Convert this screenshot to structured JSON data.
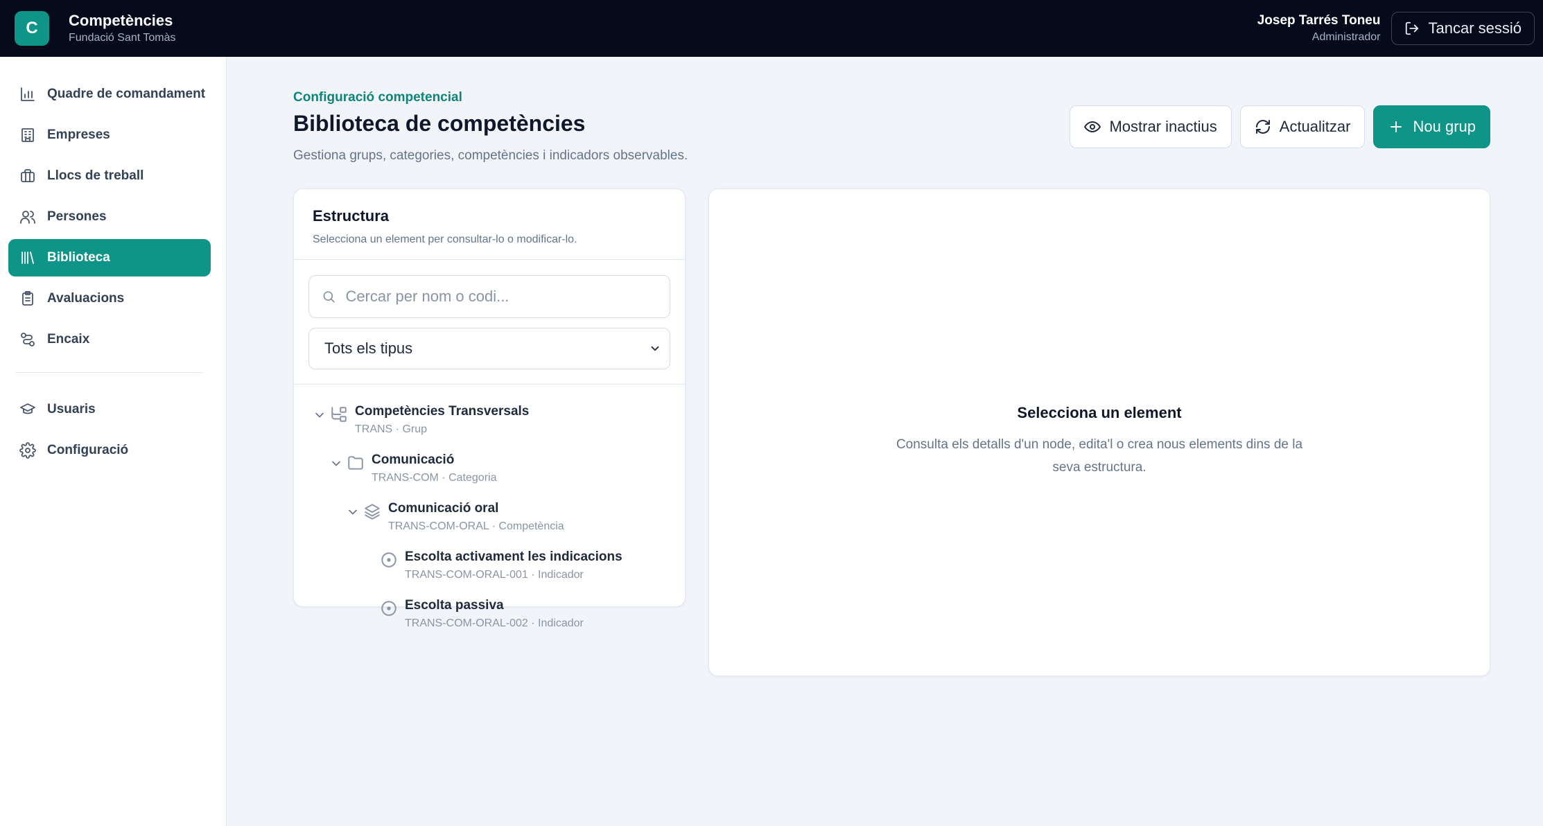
{
  "app": {
    "logo_letter": "C",
    "title": "Competències",
    "org": "Fundació Sant Tomàs"
  },
  "user": {
    "name": "Josep Tarrés Toneu",
    "role": "Administrador",
    "logout_label": "Tancar sessió"
  },
  "sidebar": {
    "items": [
      {
        "label": "Quadre de comandament",
        "icon": "bar-chart-icon"
      },
      {
        "label": "Empreses",
        "icon": "building-icon"
      },
      {
        "label": "Llocs de treball",
        "icon": "briefcase-icon"
      },
      {
        "label": "Persones",
        "icon": "users-icon"
      },
      {
        "label": "Biblioteca",
        "icon": "library-icon",
        "active": true
      },
      {
        "label": "Avaluacions",
        "icon": "clipboard-icon"
      },
      {
        "label": "Encaix",
        "icon": "route-icon"
      }
    ],
    "secondary": [
      {
        "label": "Usuaris",
        "icon": "graduation-cap-icon"
      },
      {
        "label": "Configuració",
        "icon": "gear-icon"
      }
    ]
  },
  "page": {
    "eyebrow": "Configuració competencial",
    "title": "Biblioteca de competències",
    "subtitle": "Gestiona grups, categories, competències i indicadors observables.",
    "actions": {
      "show_inactive": "Mostrar inactius",
      "refresh": "Actualitzar",
      "new_group": "Nou grup"
    }
  },
  "structure": {
    "title": "Estructura",
    "subtitle": "Selecciona un element per consultar-lo o modificar-lo.",
    "search_placeholder": "Cercar per nom o codi...",
    "type_filter": "Tots els tipus",
    "nodes": [
      {
        "label": "Competències Transversals",
        "meta": "TRANS · Grup",
        "level": 0,
        "expandable": true,
        "icon": "group-tree-icon"
      },
      {
        "label": "Comunicació",
        "meta": "TRANS-COM · Categoria",
        "level": 1,
        "expandable": true,
        "icon": "folder-icon"
      },
      {
        "label": "Comunicació oral",
        "meta": "TRANS-COM-ORAL · Competència",
        "level": 2,
        "expandable": true,
        "icon": "layers-icon"
      },
      {
        "label": "Escolta activament les indicacions",
        "meta": "TRANS-COM-ORAL-001 · Indicador",
        "level": 3,
        "expandable": false,
        "icon": "indicator-circle-icon"
      },
      {
        "label": "Escolta passiva",
        "meta": "TRANS-COM-ORAL-002 · Indicador",
        "level": 3,
        "expandable": false,
        "icon": "indicator-circle-icon"
      }
    ]
  },
  "detail": {
    "empty_title": "Selecciona un element",
    "empty_text": "Consulta els detalls d'un node, edita'l o crea nous elements dins de la seva estructura."
  }
}
